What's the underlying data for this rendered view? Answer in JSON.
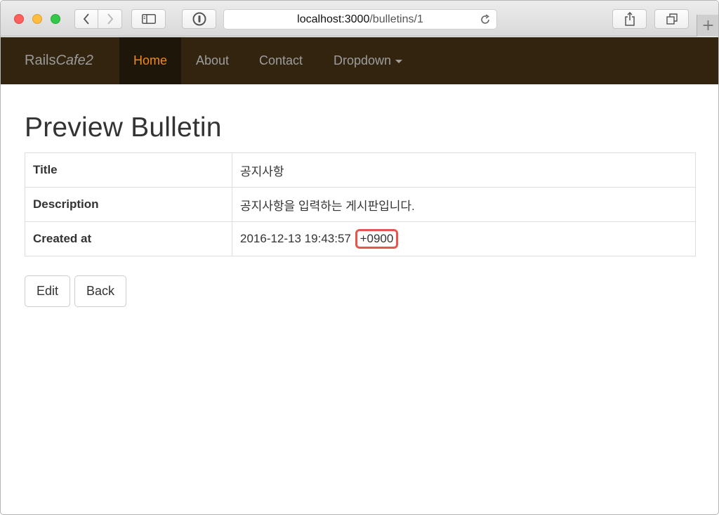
{
  "browser": {
    "url_host": "localhost:3000",
    "url_path": "/bulletins/1",
    "new_tab_label": "+"
  },
  "navbar": {
    "brand_plain": "Rails",
    "brand_italic": "Cafe2",
    "items": [
      {
        "label": "Home",
        "active": true
      },
      {
        "label": "About"
      },
      {
        "label": "Contact"
      },
      {
        "label": "Dropdown"
      }
    ],
    "colors": {
      "background": "#33240f",
      "active": "#f08a19"
    }
  },
  "page": {
    "title": "Preview Bulletin",
    "rows": [
      {
        "label": "Title",
        "value": "공지사항"
      },
      {
        "label": "Description",
        "value": "공지사항을 입력하는 게시판입니다."
      },
      {
        "label": "Created at",
        "value": "2016-12-13 19:43:57",
        "value_highlight": "+0900"
      }
    ],
    "buttons": {
      "edit": "Edit",
      "back": "Back"
    },
    "highlight_color": "#e5564d"
  }
}
